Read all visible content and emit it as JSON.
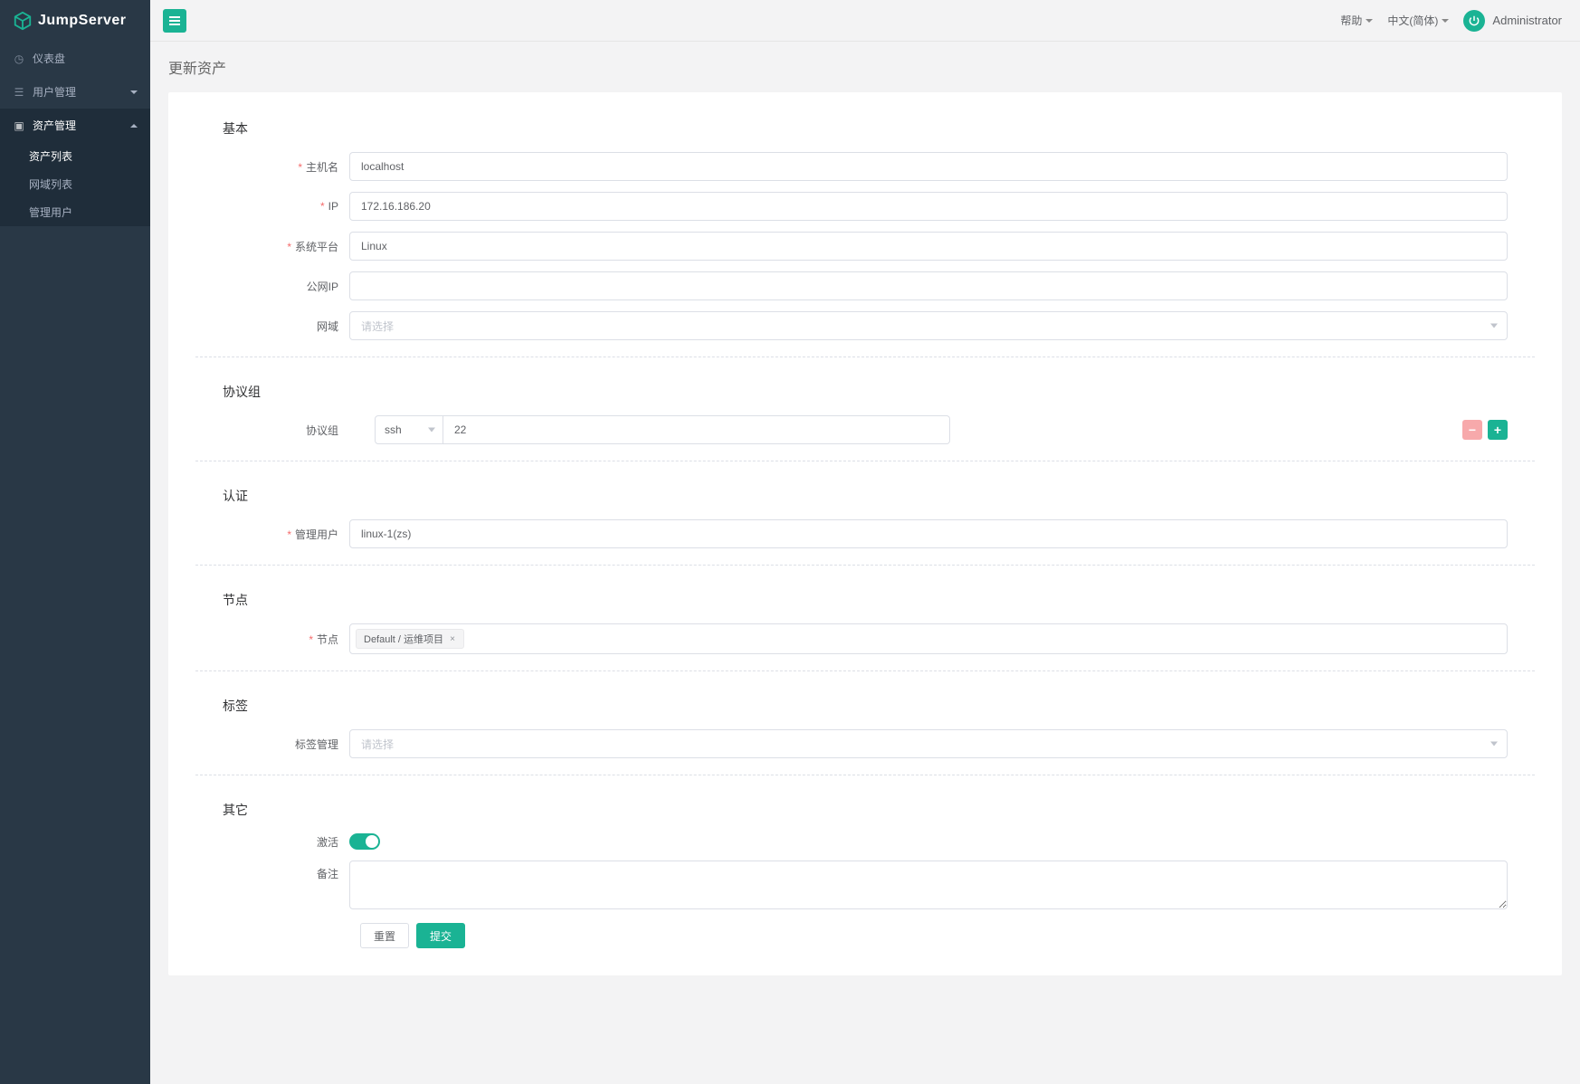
{
  "brand": "JumpServer",
  "topbar": {
    "help": "帮助",
    "language": "中文(简体)",
    "user": "Administrator"
  },
  "sidebar": {
    "dashboard": "仪表盘",
    "user_mgmt": "用户管理",
    "asset_mgmt": "资产管理",
    "sub": {
      "asset_list": "资产列表",
      "domain_list": "网域列表",
      "admin_user": "管理用户"
    }
  },
  "page": {
    "title": "更新资产"
  },
  "sections": {
    "basic": "基本",
    "protocol": "协议组",
    "auth": "认证",
    "node": "节点",
    "tag": "标签",
    "other": "其它"
  },
  "labels": {
    "hostname": "主机名",
    "ip": "IP",
    "platform": "系统平台",
    "public_ip": "公网IP",
    "domain": "网域",
    "protocol_group": "协议组",
    "admin_user": "管理用户",
    "node": "节点",
    "tag_mgmt": "标签管理",
    "active": "激活",
    "comment": "备注"
  },
  "values": {
    "hostname": "localhost",
    "ip": "172.16.186.20",
    "platform": "Linux",
    "public_ip": "",
    "domain_placeholder": "请选择",
    "protocol_name": "ssh",
    "protocol_port": "22",
    "admin_user": "linux-1(zs)",
    "node_tag": "Default / 运维项目",
    "tag_placeholder": "请选择",
    "comment": ""
  },
  "buttons": {
    "reset": "重置",
    "submit": "提交"
  }
}
